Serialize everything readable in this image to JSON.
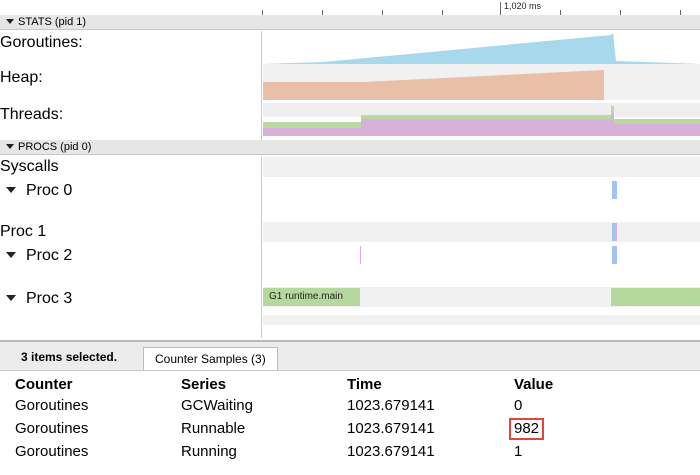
{
  "ruler": {
    "label": "1,020 ms"
  },
  "groups": {
    "stats": {
      "title": "STATS (pid 1)"
    },
    "procs": {
      "title": "PROCS (pid 0)"
    }
  },
  "rows": {
    "goroutines": "Goroutines:",
    "heap": "Heap:",
    "threads": "Threads:",
    "syscalls": "Syscalls",
    "proc0": "Proc 0",
    "proc1": "Proc 1",
    "proc2": "Proc 2",
    "proc3": "Proc 3"
  },
  "slices": {
    "proc3_main": "G1 runtime.main"
  },
  "colors": {
    "goroutines": "#a8d8ec",
    "heap": "#e9bfa8",
    "threads_green": "#b9d9a0",
    "threads_purple": "#d8b1db",
    "syscall_blue": "#a3c4f0",
    "proc_green": "#b5d99c",
    "highlight": "#e0463a"
  },
  "bottom": {
    "selection": "3 items selected.",
    "tab": "Counter Samples (3)",
    "columns": [
      "Counter",
      "Series",
      "Time",
      "Value"
    ],
    "rows": [
      [
        "Goroutines",
        "GCWaiting",
        "1023.679141",
        "0"
      ],
      [
        "Goroutines",
        "Runnable",
        "1023.679141",
        "982"
      ],
      [
        "Goroutines",
        "Running",
        "1023.679141",
        "1"
      ]
    ]
  }
}
